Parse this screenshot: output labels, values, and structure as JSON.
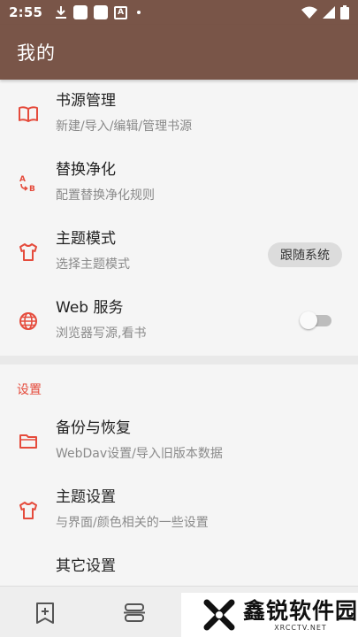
{
  "status_bar": {
    "time": "2:55",
    "a_glyph": "A"
  },
  "app_bar": {
    "title": "我的"
  },
  "items": [
    {
      "title": "书源管理",
      "subtitle": "新建/导入/编辑/管理书源",
      "icon": "book-icon"
    },
    {
      "title": "替换净化",
      "subtitle": "配置替换净化规则",
      "icon": "replace-ab-icon"
    },
    {
      "title": "主题模式",
      "subtitle": "选择主题模式",
      "icon": "tshirt-icon",
      "chip": "跟随系统"
    },
    {
      "title": "Web 服务",
      "subtitle": "浏览器写源,看书",
      "icon": "globe-icon",
      "switch_on": false
    }
  ],
  "settings_section": {
    "header": "设置",
    "items": [
      {
        "title": "备份与恢复",
        "subtitle": "WebDav设置/导入旧版本数据",
        "icon": "folder-icon"
      },
      {
        "title": "主题设置",
        "subtitle": "与界面/颜色相关的一些设置",
        "icon": "tshirt-icon"
      },
      {
        "title": "其它设置",
        "subtitle": "",
        "icon": "hexagon-settings-icon"
      }
    ]
  },
  "watermark": {
    "name": "鑫锐软件园",
    "url": "XRCCTV.NET"
  },
  "colors": {
    "primary": "#795548",
    "accent": "#e54b3c",
    "background": "#f5f5f5"
  }
}
